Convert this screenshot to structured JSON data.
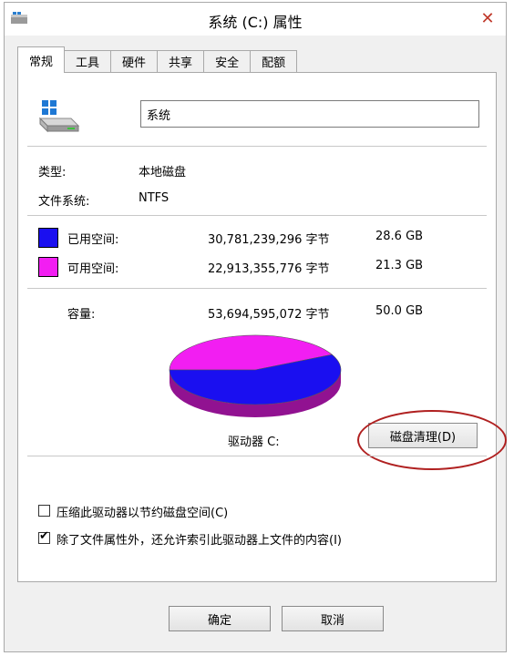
{
  "window": {
    "title": "系统 (C:) 属性",
    "close_glyph": "✕"
  },
  "tabs": [
    {
      "label": "常规",
      "active": true
    },
    {
      "label": "工具"
    },
    {
      "label": "硬件"
    },
    {
      "label": "共享"
    },
    {
      "label": "安全"
    },
    {
      "label": "配额"
    }
  ],
  "general": {
    "volume_name": "系统",
    "type_label": "类型:",
    "type_value": "本地磁盘",
    "fs_label": "文件系统:",
    "fs_value": "NTFS",
    "used": {
      "label": "已用空间:",
      "bytes": "30,781,239,296 字节",
      "size": "28.6 GB",
      "color": "#1a0ff0"
    },
    "free": {
      "label": "可用空间:",
      "bytes": "22,913,355,776 字节",
      "size": "21.3 GB",
      "color": "#f21ef2"
    },
    "capacity": {
      "label": "容量:",
      "bytes": "53,694,595,072 字节",
      "size": "50.0 GB"
    },
    "drive_label": "驱动器 C:",
    "cleanup_button": "磁盘清理(D)",
    "compress_label": "压缩此驱动器以节约磁盘空间(C)",
    "compress_checked": false,
    "index_label": "除了文件属性外，还允许索引此驱动器上文件的内容(I)",
    "index_checked": true
  },
  "chart_data": {
    "type": "pie",
    "categories": [
      "已用空间",
      "可用空间"
    ],
    "values": [
      28.6,
      21.3
    ],
    "colors": [
      "#1a0ff0",
      "#f21ef2"
    ]
  },
  "footer": {
    "ok_button": "确定",
    "cancel_button": "取消"
  }
}
